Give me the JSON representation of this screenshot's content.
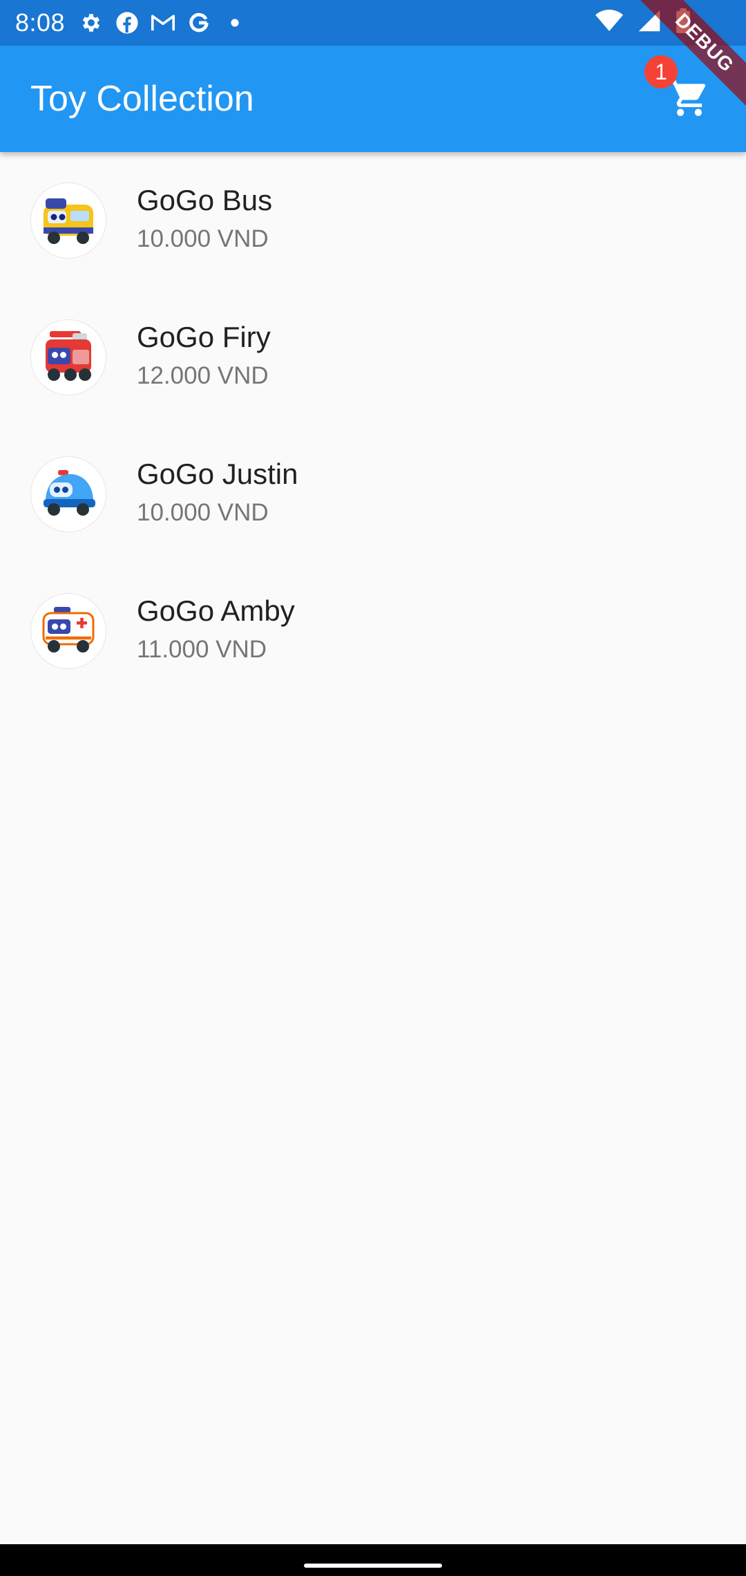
{
  "status_bar": {
    "time": "8:08"
  },
  "app_bar": {
    "title": "Toy Collection",
    "cart_badge_count": "1"
  },
  "debug_banner": {
    "label": "DEBUG"
  },
  "toys": [
    {
      "name": "GoGo Bus",
      "price": "10.000 VND",
      "color": "#f5c518"
    },
    {
      "name": "GoGo Firy",
      "price": "12.000 VND",
      "color": "#e53935"
    },
    {
      "name": "GoGo Justin",
      "price": "10.000 VND",
      "color": "#42a5f5"
    },
    {
      "name": "GoGo Amby",
      "price": "11.000 VND",
      "color": "#ef6c00"
    }
  ],
  "colors": {
    "app_bar": "#2196f3",
    "status_bar": "#1976d2",
    "badge": "#f44336"
  }
}
